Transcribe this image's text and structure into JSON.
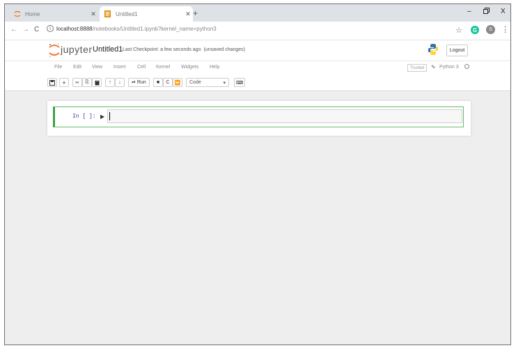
{
  "browser": {
    "tabs": [
      {
        "title": "Home",
        "active": false,
        "favicon": "jupyter-favicon-icon"
      },
      {
        "title": "Untitled1",
        "active": true,
        "favicon": "notebook-favicon-icon"
      }
    ],
    "new_tab": "+",
    "window_controls": {
      "minimize": "–",
      "maximize": "🗗",
      "close": "X"
    },
    "nav": {
      "back": "←",
      "forward": "→",
      "reload": "C"
    },
    "url_host": "localhost:8888",
    "url_path": "/notebooks/Untitled1.ipynb?kernel_name=python3",
    "info_icon": "i",
    "star": "☆",
    "extension_badge": "G",
    "profile_initial": "S",
    "menu": "⋮",
    "colors": {
      "tabstrip": "#dee1e6",
      "extension": "#15c39a"
    }
  },
  "jupyter": {
    "brand": "jupyter",
    "notebook_title": "Untitled1",
    "checkpoint": "Last Checkpoint: a few seconds ago",
    "unsaved": "(unsaved changes)",
    "logout_label": "Logout",
    "menu_items": [
      "File",
      "Edit",
      "View",
      "Insert",
      "Cell",
      "Kernel",
      "Widgets",
      "Help"
    ],
    "trusted_label": "Trusted",
    "kernel_name": "Python 3",
    "toolbar": {
      "save": "🖫",
      "insert": "+",
      "cut": "✂",
      "copy": "⎘",
      "paste": "📋",
      "move_up": "↑",
      "move_down": "↓",
      "run": "⏯ Run",
      "stop": "■",
      "restart": "C",
      "restart_run_all": "⏩",
      "cell_type": "Code",
      "cell_type_caret": "▾",
      "command_palette": "⌨"
    },
    "cell": {
      "prompt": "In [ ]:",
      "run_glyph": "▶"
    },
    "colors": {
      "accent_green": "#42a047",
      "prompt_blue": "#303f9f",
      "logo_orange": "#f37726",
      "python_blue": "#3572a5",
      "python_yellow": "#ffd43b"
    }
  }
}
